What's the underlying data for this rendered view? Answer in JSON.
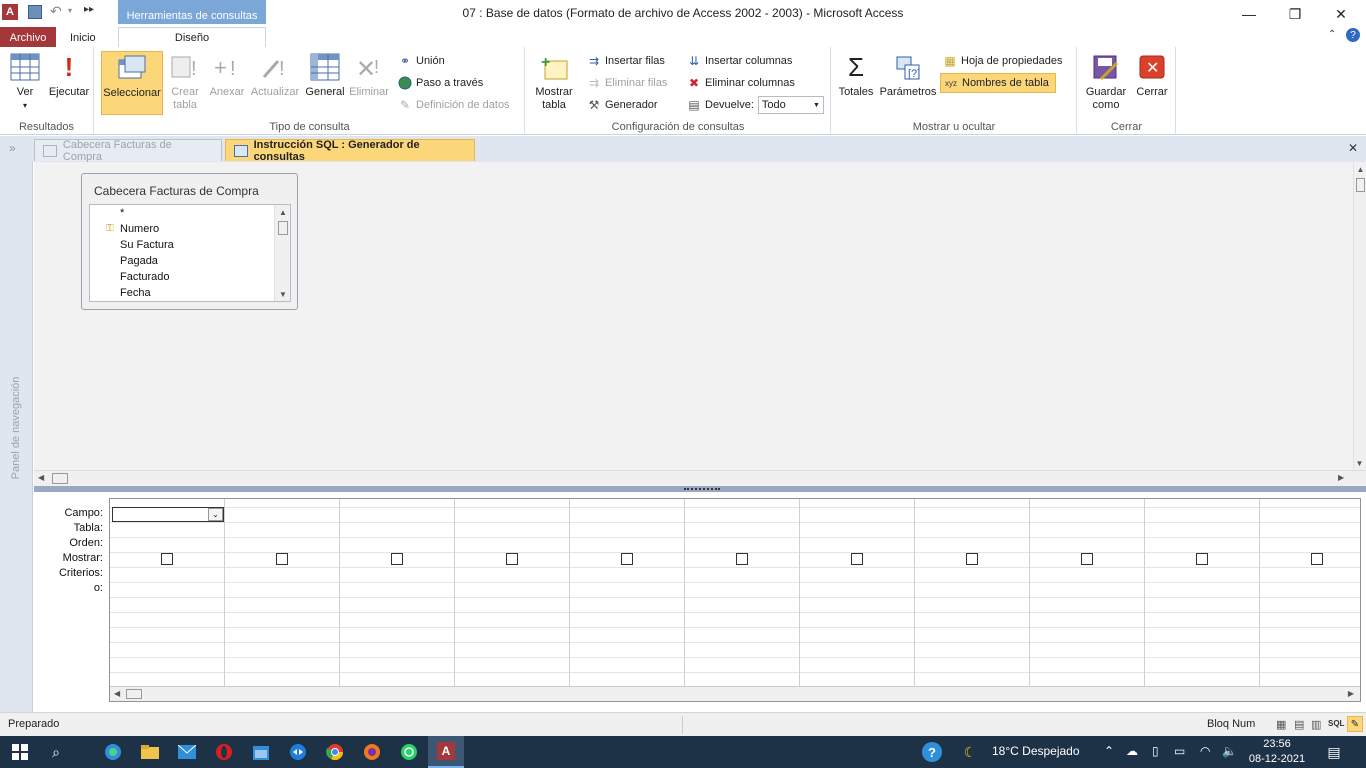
{
  "window": {
    "title": "07 : Base de datos (Formato de archivo de Access 2002 - 2003)  -  Microsoft Access",
    "context_tab": "Herramientas de consultas"
  },
  "tabs": {
    "archivo": "Archivo",
    "inicio": "Inicio",
    "diseno": "Diseño"
  },
  "ribbon": {
    "resultados": {
      "label": "Resultados",
      "ver": "Ver",
      "ejecutar": "Ejecutar"
    },
    "tipo": {
      "label": "Tipo de consulta",
      "seleccionar": "Seleccionar",
      "crear_tabla": "Crear tabla",
      "anexar": "Anexar",
      "actualizar": "Actualizar",
      "general": "General",
      "eliminar": "Eliminar",
      "union": "Unión",
      "paso_a_traves": "Paso a través",
      "definicion": "Definición de datos"
    },
    "config": {
      "label": "Configuración de consultas",
      "mostrar_tabla": "Mostrar tabla",
      "insertar_filas": "Insertar filas",
      "eliminar_filas": "Eliminar filas",
      "generador": "Generador",
      "insertar_columnas": "Insertar columnas",
      "eliminar_columnas": "Eliminar columnas",
      "devuelve_label": "Devuelve:",
      "devuelve_value": "Todo"
    },
    "mostrar": {
      "label": "Mostrar u ocultar",
      "totales": "Totales",
      "parametros": "Parámetros",
      "hoja_propiedades": "Hoja de propiedades",
      "nombres_tabla": "Nombres de tabla"
    },
    "cerrar": {
      "label": "Cerrar",
      "guardar_como": "Guardar como",
      "cerrar": "Cerrar"
    }
  },
  "doc_tabs": {
    "tab1": "Cabecera Facturas de Compra",
    "tab2": "Instrucción SQL : Generador de consultas"
  },
  "nav_pane": {
    "label": "Panel de navegación"
  },
  "table_box": {
    "title": "Cabecera Facturas de Compra",
    "fields": [
      "*",
      "Numero",
      "Su Factura",
      "Pagada",
      "Facturado",
      "Fecha"
    ]
  },
  "qbe": {
    "row_labels": [
      "Campo:",
      "Tabla:",
      "Orden:",
      "Mostrar:",
      "Criterios:",
      "o:"
    ],
    "columns": 11
  },
  "status": {
    "left": "Preparado",
    "right": "Bloq Num",
    "sql": "SQL"
  },
  "taskbar": {
    "weather": "18°C  Despejado",
    "time": "23:56",
    "date": "08-12-2021"
  }
}
